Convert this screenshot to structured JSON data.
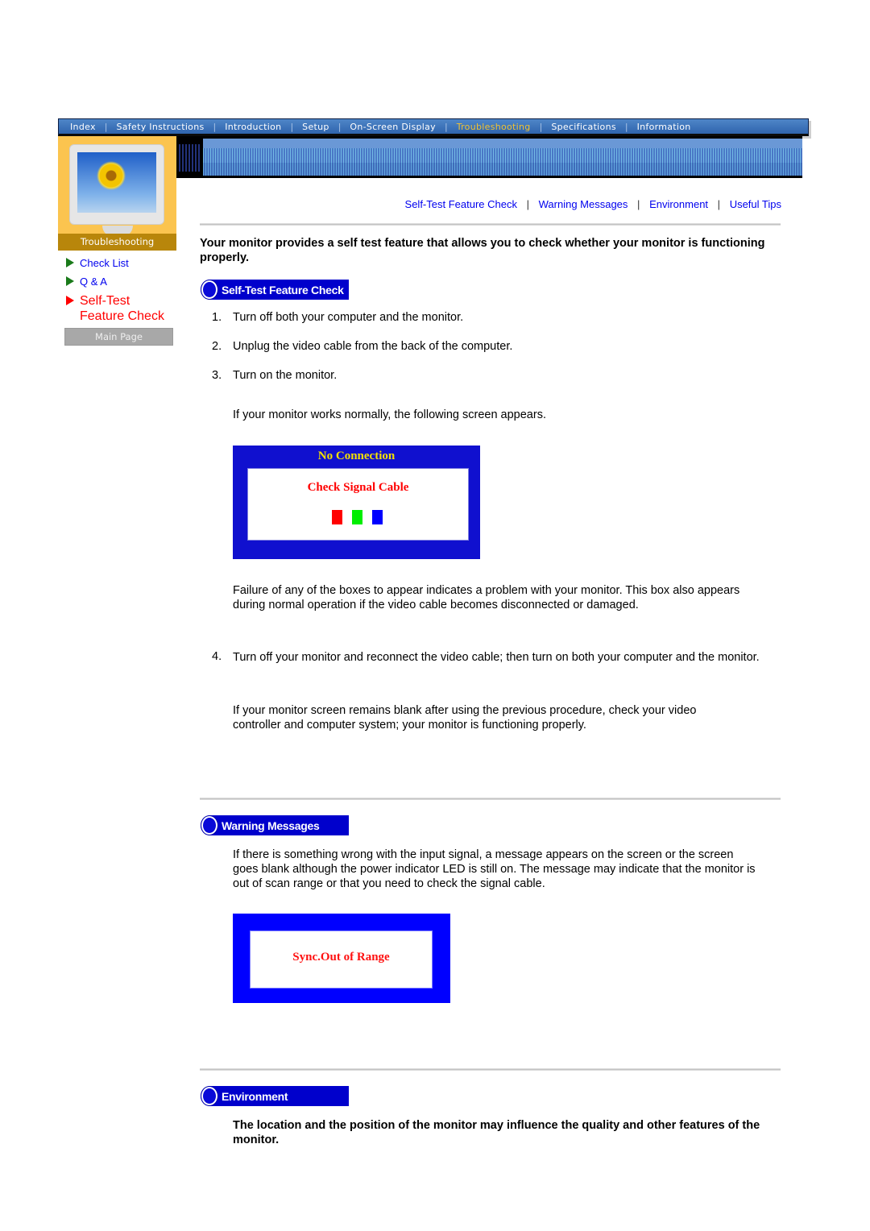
{
  "topnav": {
    "items": [
      {
        "label": "Index",
        "active": false
      },
      {
        "label": "Safety Instructions",
        "active": false
      },
      {
        "label": "Introduction",
        "active": false
      },
      {
        "label": "Setup",
        "active": false
      },
      {
        "label": "On-Screen Display",
        "active": false
      },
      {
        "label": "Troubleshooting",
        "active": true
      },
      {
        "label": "Specifications",
        "active": false
      },
      {
        "label": "Information",
        "active": false
      }
    ],
    "separator": "|"
  },
  "hero": {
    "caption": "Troubleshooting"
  },
  "sidebar": {
    "links": [
      {
        "label": "Check List",
        "current": false
      },
      {
        "label": "Q & A",
        "current": false
      },
      {
        "label": "Self-Test Feature Check",
        "current": true
      }
    ],
    "main_page_label": "Main Page"
  },
  "subnav": {
    "links": [
      "Self-Test Feature Check",
      "Warning Messages",
      "Environment",
      "Useful Tips"
    ],
    "separator": "|"
  },
  "intro": "Your monitor provides a self test feature that allows you to check whether your monitor is functioning properly.",
  "self_test": {
    "heading": "Self-Test Feature Check",
    "steps": [
      {
        "num": "1.",
        "text": "Turn off both your computer and the monitor."
      },
      {
        "num": "2.",
        "text": "Unplug the video cable from the back of the computer."
      },
      {
        "num": "3.",
        "text": "Turn on the monitor."
      }
    ],
    "normal_note": "If your monitor works normally, the following screen appears.",
    "osd": {
      "title": "No Connection",
      "message": "Check Signal Cable",
      "box_colors": [
        "#ff0000",
        "#00ee00",
        "#0000ff"
      ]
    },
    "failure_note": "Failure of any of the boxes to appear indicates a problem with your monitor. This box also appears during normal operation if the video cable becomes disconnected or damaged.",
    "step4": {
      "num": "4.",
      "text": "Turn off your monitor and reconnect the video cable; then turn on both your computer and the monitor."
    },
    "blank_note": "If your monitor screen remains blank after using the previous procedure, check your video controller and computer system; your monitor is functioning properly."
  },
  "warning": {
    "heading": "Warning Messages",
    "text": "If there is something wrong with the input signal, a message appears on the screen or the screen goes blank although the power indicator LED is still on. The message may indicate that the monitor is out of scan range or that you need to check the signal cable.",
    "osd_message": "Sync.Out of Range"
  },
  "environment": {
    "heading": "Environment",
    "text": "The location and the position of the monitor may influence the quality and other features of the monitor."
  }
}
